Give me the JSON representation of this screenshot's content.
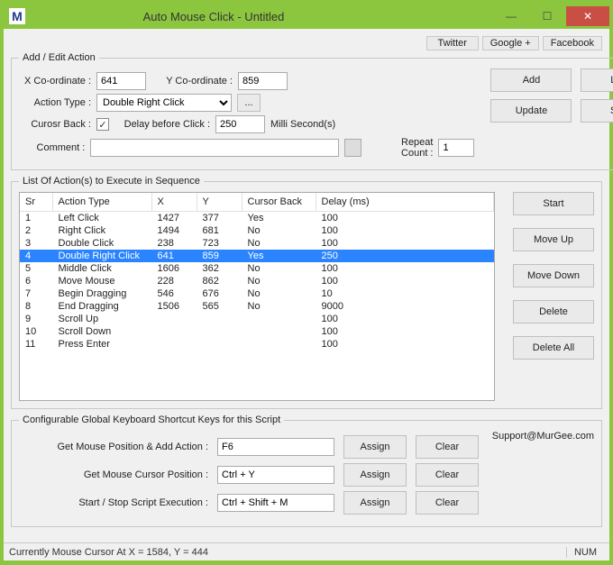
{
  "window": {
    "title": "Auto Mouse Click - Untitled",
    "logo": "M"
  },
  "toplinks": [
    "Twitter",
    "Google +",
    "Facebook"
  ],
  "editGroup": {
    "legend": "Add / Edit Action",
    "xLabel": "X Co-ordinate :",
    "xValue": "641",
    "yLabel": "Y Co-ordinate :",
    "yValue": "859",
    "actionTypeLabel": "Action Type :",
    "actionTypeValue": "Double Right Click",
    "moreBtn": "...",
    "cursorBackLabel": "Curosr Back :",
    "cursorBackChecked": "✓",
    "delayLabel": "Delay before Click :",
    "delayValue": "250",
    "delayUnit": "Milli Second(s)",
    "commentLabel": "Comment :",
    "commentValue": "",
    "repeatLabel": "Repeat Count :",
    "repeatValue": "1",
    "addBtn": "Add",
    "loadBtn": "Load",
    "updateBtn": "Update",
    "saveBtn": "Save"
  },
  "listGroup": {
    "legend": "List Of Action(s) to Execute in Sequence",
    "headers": {
      "sr": "Sr",
      "type": "Action Type",
      "x": "X",
      "y": "Y",
      "cb": "Cursor Back",
      "delay": "Delay (ms)"
    },
    "rows": [
      {
        "sr": "1",
        "type": "Left Click",
        "x": "1427",
        "y": "377",
        "cb": "Yes",
        "delay": "100",
        "sel": false
      },
      {
        "sr": "2",
        "type": "Right Click",
        "x": "1494",
        "y": "681",
        "cb": "No",
        "delay": "100",
        "sel": false
      },
      {
        "sr": "3",
        "type": "Double Click",
        "x": "238",
        "y": "723",
        "cb": "No",
        "delay": "100",
        "sel": false
      },
      {
        "sr": "4",
        "type": "Double Right Click",
        "x": "641",
        "y": "859",
        "cb": "Yes",
        "delay": "250",
        "sel": true
      },
      {
        "sr": "5",
        "type": "Middle Click",
        "x": "1606",
        "y": "362",
        "cb": "No",
        "delay": "100",
        "sel": false
      },
      {
        "sr": "6",
        "type": "Move Mouse",
        "x": "228",
        "y": "862",
        "cb": "No",
        "delay": "100",
        "sel": false
      },
      {
        "sr": "7",
        "type": "Begin Dragging",
        "x": "546",
        "y": "676",
        "cb": "No",
        "delay": "10",
        "sel": false
      },
      {
        "sr": "8",
        "type": "End Dragging",
        "x": "1506",
        "y": "565",
        "cb": "No",
        "delay": "9000",
        "sel": false
      },
      {
        "sr": "9",
        "type": "Scroll Up",
        "x": "",
        "y": "",
        "cb": "",
        "delay": "100",
        "sel": false
      },
      {
        "sr": "10",
        "type": "Scroll Down",
        "x": "",
        "y": "",
        "cb": "",
        "delay": "100",
        "sel": false
      },
      {
        "sr": "11",
        "type": "Press Enter",
        "x": "",
        "y": "",
        "cb": "",
        "delay": "100",
        "sel": false
      }
    ],
    "sideButtons": {
      "start": "Start",
      "moveUp": "Move Up",
      "moveDown": "Move Down",
      "delete": "Delete",
      "deleteAll": "Delete All"
    }
  },
  "shortcutsGroup": {
    "legend": "Configurable Global Keyboard Shortcut Keys for this Script",
    "support": "Support@MurGee.com",
    "rows": [
      {
        "label": "Get Mouse Position & Add Action :",
        "value": "F6"
      },
      {
        "label": "Get Mouse Cursor Position :",
        "value": "Ctrl + Y"
      },
      {
        "label": "Start / Stop Script Execution :",
        "value": "Ctrl + Shift + M"
      }
    ],
    "assign": "Assign",
    "clear": "Clear"
  },
  "status": {
    "text": "Currently Mouse Cursor At X = 1584, Y = 444",
    "num": "NUM"
  }
}
